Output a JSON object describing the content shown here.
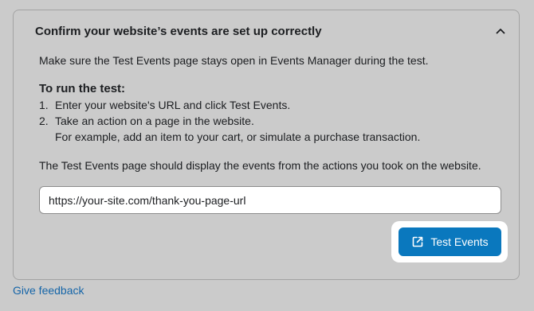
{
  "panel": {
    "title": "Confirm your website’s events are set up correctly",
    "toggle_icon": "chevron-up-icon",
    "intro": "Make sure the Test Events page stays open in Events Manager during the test.",
    "steps_title": "To run the test:",
    "steps": [
      {
        "num": "1.",
        "text": "Enter your website's URL and click Test Events."
      },
      {
        "num": "2.",
        "text": "Take an action on a page in the website."
      }
    ],
    "step_note": "For example, add an item to your cart, or simulate a purchase transaction.",
    "outro": "The Test Events page should display the events from the actions you took on the website.",
    "url_input": {
      "value": "https://your-site.com/thank-you-page-url"
    },
    "test_button": {
      "label": "Test Events",
      "icon": "external-link-icon"
    }
  },
  "feedback_link": "Give feedback",
  "colors": {
    "background": "#cbcbcb",
    "button": "#0a78be",
    "link": "#1565a8"
  }
}
